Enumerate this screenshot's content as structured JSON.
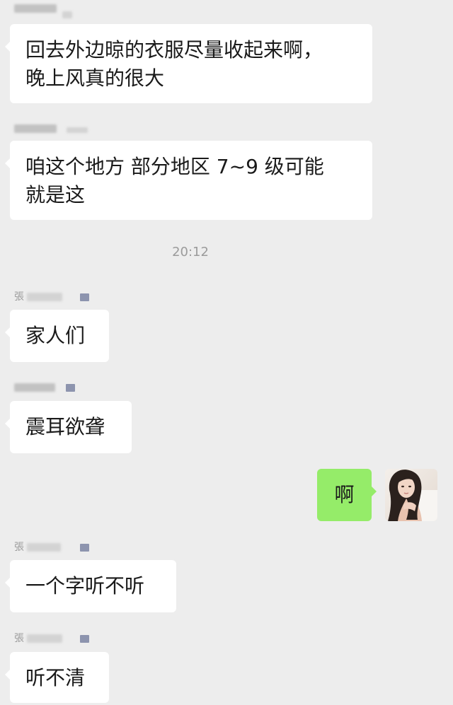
{
  "messages": [
    {
      "text": "回去外边晾的衣服尽量收起来啊，\n晚上风真的很大"
    },
    {
      "text": "咱这个地方 部分地区 7~9 级可能\n就是这"
    },
    {
      "text": "家人们"
    },
    {
      "text": "震耳欲聋"
    },
    {
      "text": "啊"
    },
    {
      "text": "一个字听不听"
    },
    {
      "text": "听不清"
    }
  ],
  "timestamp": "20:12",
  "senders": {
    "name_char_1": "張",
    "name_char_2": "張",
    "name_char_3": "張"
  },
  "colors": {
    "background": "#ededed",
    "bubble_incoming": "#ffffff",
    "bubble_outgoing": "#95ec69",
    "tag": "#8d94ae"
  }
}
